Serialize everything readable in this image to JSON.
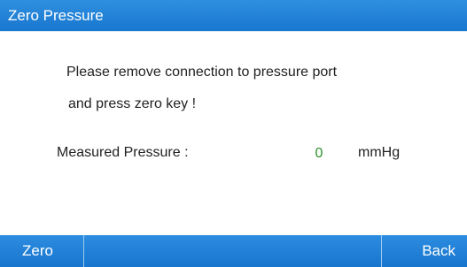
{
  "window": {
    "title": "Zero Pressure"
  },
  "message": {
    "line1": "Please remove connection to pressure port",
    "line2": "and press zero key !"
  },
  "measurement": {
    "label": "Measured Pressure :",
    "value": "0",
    "unit": "mmHg"
  },
  "softkeys": {
    "left": "Zero",
    "right": "Back"
  },
  "colors": {
    "bar_blue": "#1877cf",
    "value_green": "#2a8f2a"
  }
}
